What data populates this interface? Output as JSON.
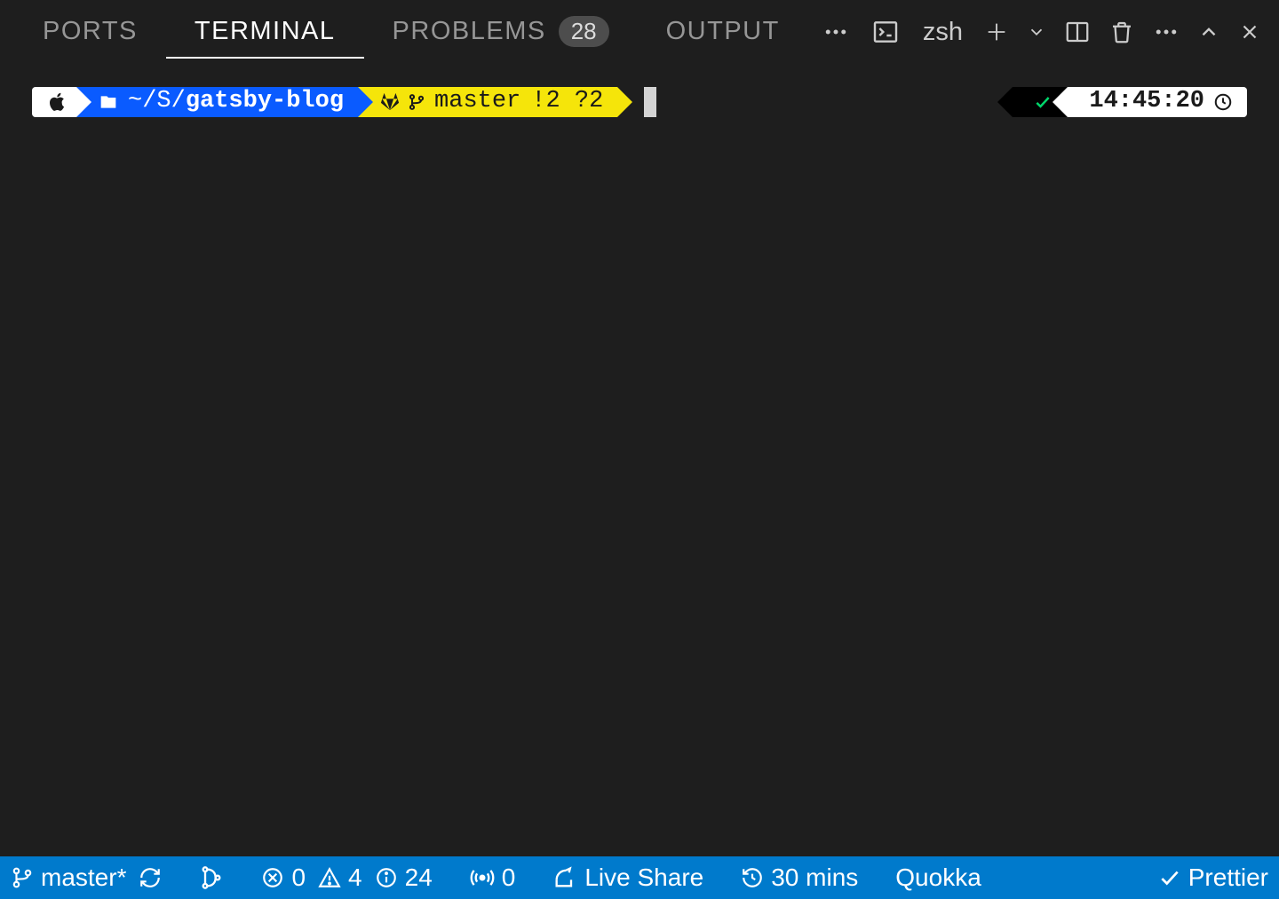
{
  "tabs": {
    "ports": "PORTS",
    "terminal": "TERMINAL",
    "problems": "PROBLEMS",
    "problems_count": "28",
    "output": "OUTPUT"
  },
  "terminal_header": {
    "shell": "zsh"
  },
  "prompt": {
    "path_prefix": "~/S/",
    "path_bold": "gatsby-blog",
    "branch": "master",
    "git_flags": "!2 ?2",
    "time": "14:45:20"
  },
  "status": {
    "branch": "master*",
    "errors": "0",
    "warnings": "4",
    "info": "24",
    "ports": "0",
    "live_share": "Live Share",
    "timer": "30 mins",
    "quokka": "Quokka",
    "prettier": "Prettier"
  }
}
